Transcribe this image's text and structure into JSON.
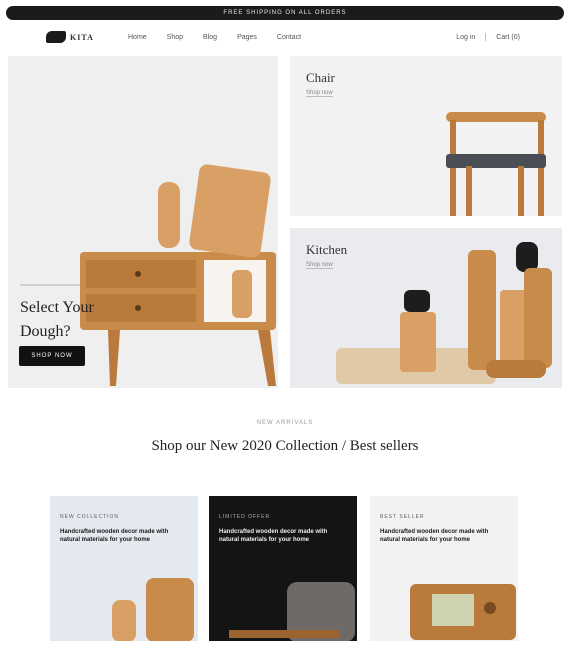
{
  "announcement": {
    "text": "FREE SHIPPING ON ALL ORDERS"
  },
  "brand": {
    "name": "KITA"
  },
  "nav": {
    "items": [
      "Home",
      "Shop",
      "Blog",
      "Pages",
      "Contact"
    ]
  },
  "header_right": {
    "account": "Log in",
    "cart": "Cart (0)"
  },
  "hero": {
    "title_line1": "Select Your",
    "title_line2": "Dough?",
    "button": "SHOP NOW"
  },
  "cards": [
    {
      "title": "Chair",
      "link": "Shop now"
    },
    {
      "title": "Kitchen",
      "link": "Shop now"
    }
  ],
  "section": {
    "kicker": "NEW ARRIVALS",
    "title": "Shop our New 2020 Collection / Best sellers"
  },
  "promos": [
    {
      "kicker": "NEW COLLECTION",
      "text": "Handcrafted wooden decor made with natural materials for your home"
    },
    {
      "kicker": "LIMITED OFFER",
      "text": "Handcrafted wooden decor made with natural materials for your home"
    },
    {
      "kicker": "BEST SELLER",
      "text": "Handcrafted wooden decor made with natural materials for your home"
    }
  ],
  "colors": {
    "accent": "#111111",
    "wood": "#c98b4a",
    "wood_dark": "#9a6330"
  }
}
